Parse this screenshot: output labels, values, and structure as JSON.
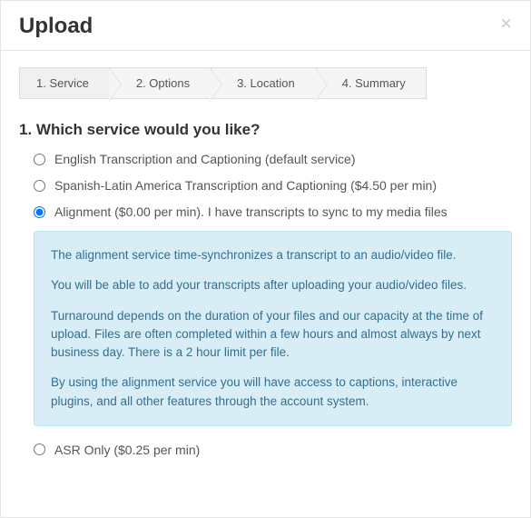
{
  "header": {
    "title": "Upload",
    "close_label": "×"
  },
  "steps": [
    {
      "label": "1. Service",
      "active": true
    },
    {
      "label": "2. Options",
      "active": false
    },
    {
      "label": "3. Location",
      "active": false
    },
    {
      "label": "4. Summary",
      "active": false
    }
  ],
  "question": "1. Which service would you like?",
  "options": [
    {
      "label": "English Transcription and Captioning (default service)",
      "selected": false
    },
    {
      "label": "Spanish-Latin America Transcription and Captioning ($4.50 per min)",
      "selected": false
    },
    {
      "label": "Alignment ($0.00 per min). I have transcripts to sync to my media files",
      "selected": true
    }
  ],
  "info": {
    "p1": "The alignment service time-synchronizes a transcript to an audio/video file.",
    "p2": "You will be able to add your transcripts after uploading your audio/video files.",
    "p3": "Turnaround depends on the duration of your files and our capacity at the time of upload. Files are often completed within a few hours and almost always by next business day. There is a 2 hour limit per file.",
    "p4": "By using the alignment service you will have access to captions, interactive plugins, and all other features through the account system."
  },
  "cutoff_option": "ASR Only ($0.25 per min)"
}
